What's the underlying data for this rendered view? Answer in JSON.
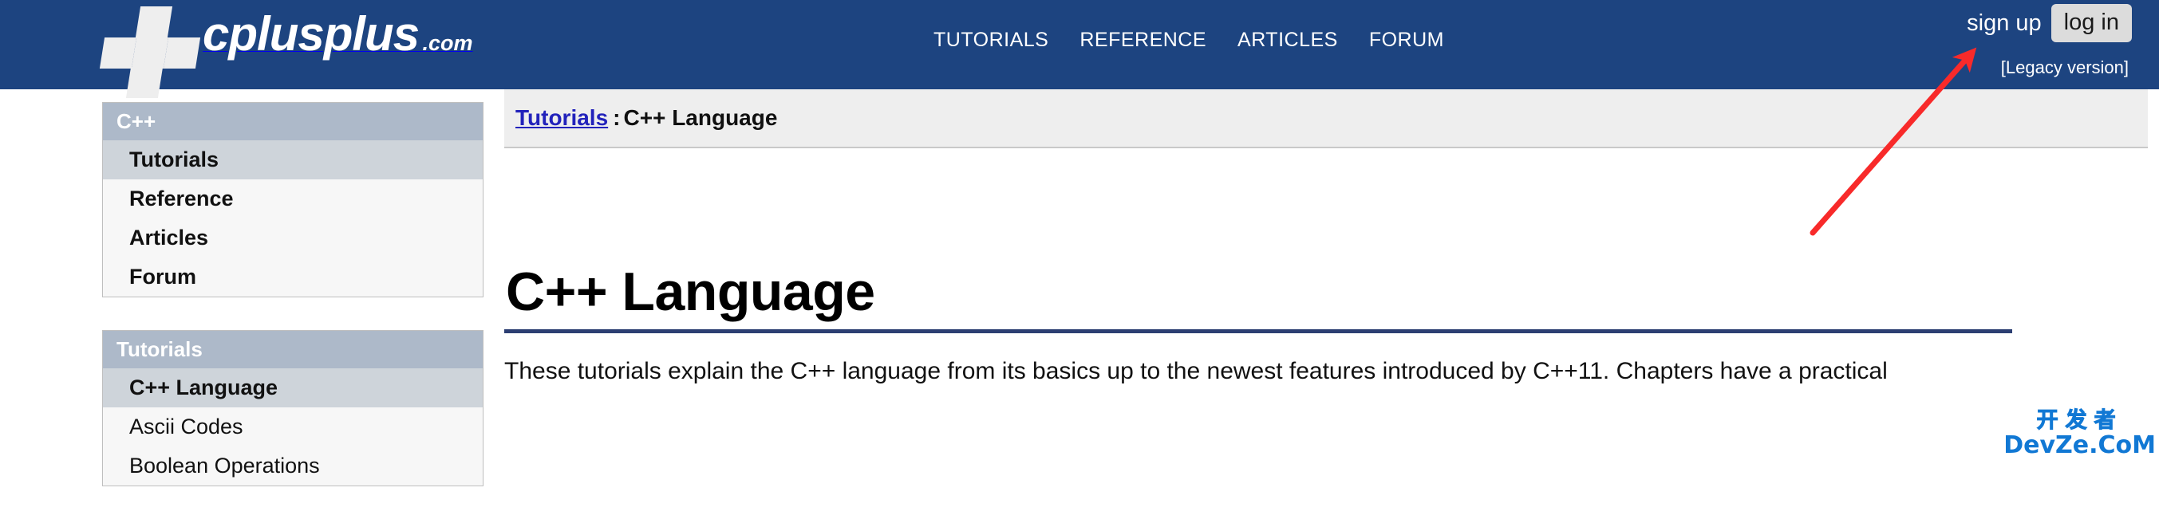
{
  "header": {
    "logo": {
      "name": "cplusplus",
      "tld": ".com",
      "mark_icon": "cplusplus-blocks-logo-icon"
    },
    "nav": [
      {
        "label": "TUTORIALS"
      },
      {
        "label": "REFERENCE"
      },
      {
        "label": "ARTICLES"
      },
      {
        "label": "FORUM"
      }
    ],
    "account": {
      "sign_up_label": "sign up",
      "log_in_label": "log in"
    },
    "legacy_label": "[Legacy version]",
    "background_color": "#1d4480"
  },
  "sidebar": {
    "boxes": [
      {
        "title": "C++",
        "items": [
          {
            "label": "Tutorials",
            "active": true,
            "bold": true
          },
          {
            "label": "Reference",
            "active": false,
            "bold": true
          },
          {
            "label": "Articles",
            "active": false,
            "bold": true
          },
          {
            "label": "Forum",
            "active": false,
            "bold": true
          }
        ]
      },
      {
        "title": "Tutorials",
        "items": [
          {
            "label": "C++ Language",
            "active": true,
            "bold": true
          },
          {
            "label": "Ascii Codes",
            "active": false,
            "bold": false
          },
          {
            "label": "Boolean Operations",
            "active": false,
            "bold": false
          }
        ]
      }
    ],
    "header_color": "#adb9c9",
    "active_color": "#ced4da"
  },
  "content": {
    "breadcrumb": {
      "link_label": "Tutorials",
      "separator": ":",
      "current_label": "C++ Language"
    },
    "title": "C++ Language",
    "rule_color": "#2c3e72",
    "paragraph": "These tutorials explain the C++ language from its basics up to the newest features introduced by C++11. Chapters have a practical"
  },
  "annotation": {
    "arrow_icon": "red-arrow-pointing-to-legacy-version",
    "color": "#f82a2a"
  },
  "watermark": {
    "cn_text": "开发者",
    "en_text": "DevZe.CoM",
    "color": "#1178d4"
  }
}
